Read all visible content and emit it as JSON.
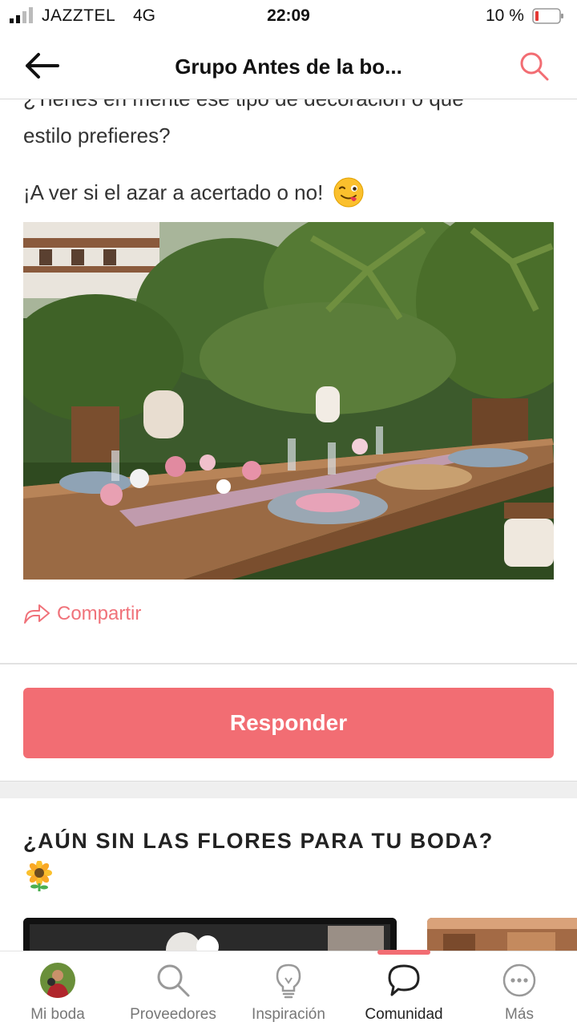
{
  "status_bar": {
    "carrier": "JAZZTEL",
    "network": "4G",
    "time": "22:09",
    "battery": "10 %"
  },
  "header": {
    "title": "Grupo Antes de la bo...",
    "back_icon": "arrow-left-icon",
    "search_icon": "search-icon"
  },
  "post": {
    "clipped_line": "¿Tienes en mente ese tipo de decoración o que",
    "paragraph_1": "estilo prefieres?",
    "paragraph_2": "¡A ver si el azar a acertado o no!",
    "emoji": "winking-tongue-emoji",
    "share_label": "Compartir"
  },
  "reply_button": "Responder",
  "promo": {
    "title": "¿AÚN SIN LAS FLORES PARA TU BODA?",
    "emoji": "sunflower-emoji"
  },
  "tabbar": {
    "tabs": [
      {
        "label": "Mi boda",
        "icon": "avatar"
      },
      {
        "label": "Proveedores",
        "icon": "search-icon"
      },
      {
        "label": "Inspiración",
        "icon": "lightbulb-icon"
      },
      {
        "label": "Comunidad",
        "icon": "chat-bubble-icon",
        "active": true
      },
      {
        "label": "Más",
        "icon": "more-dots-icon"
      }
    ]
  },
  "colors": {
    "accent": "#f26d73",
    "battery_low": "#e53935"
  }
}
